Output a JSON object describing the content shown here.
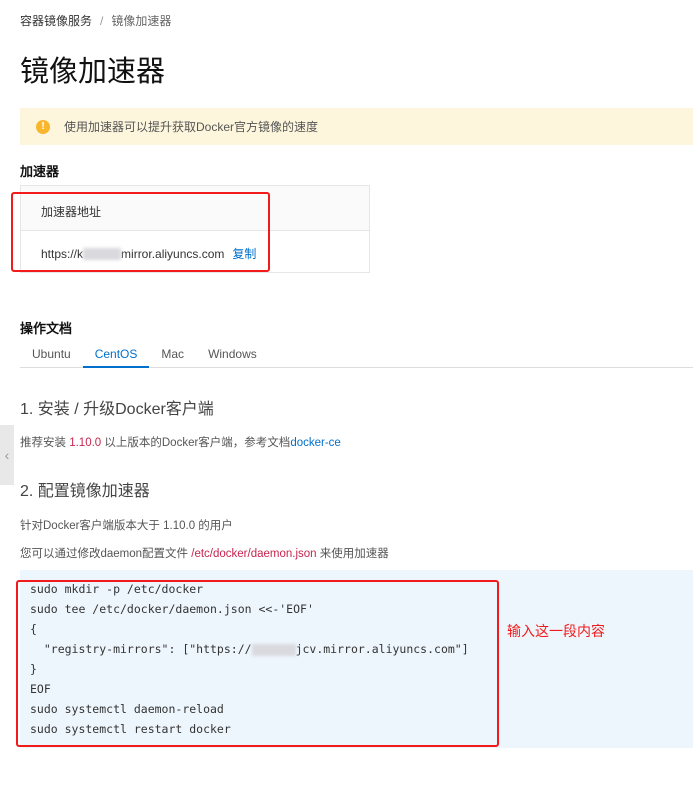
{
  "breadcrumb": {
    "parent": "容器镜像服务",
    "separator": "/",
    "current": "镜像加速器"
  },
  "page_title": "镜像加速器",
  "alert": {
    "icon": "warning-icon",
    "text": "使用加速器可以提升获取Docker官方镜像的速度"
  },
  "accelerator": {
    "section_title": "加速器",
    "column_header": "加速器地址",
    "url_prefix": "https://k",
    "url_suffix": "mirror.aliyuncs.com",
    "copy_label": "复制"
  },
  "docs": {
    "section_title": "操作文档",
    "tabs": [
      "Ubuntu",
      "CentOS",
      "Mac",
      "Windows"
    ],
    "active_tab": "CentOS",
    "step1_title": "1. 安装 / 升级Docker客户端",
    "step1_text_a": "推荐安装 ",
    "step1_version": "1.10.0",
    "step1_text_b": " 以上版本的Docker客户端，参考文档",
    "step1_link": "docker-ce",
    "step2_title": "2. 配置镜像加速器",
    "step2_text1": "针对Docker客户端版本大于 1.10.0 的用户",
    "step2_text2_a": "您可以通过修改daemon配置文件 ",
    "step2_path": "/etc/docker/daemon.json",
    "step2_text2_b": " 来使用加速器",
    "code_lines": [
      "sudo mkdir -p /etc/docker",
      "sudo tee /etc/docker/daemon.json <<-'EOF'",
      "{",
      "  \"registry-mirrors\": [\"https://",
      "}",
      "EOF",
      "sudo systemctl daemon-reload",
      "sudo systemctl restart docker"
    ],
    "code_line4_suffix": "jcv.mirror.aliyuncs.com\"]"
  },
  "annotation": "输入这一段内容",
  "colors": {
    "accent": "#0070cc",
    "highlight": "#f21b1b",
    "alert_bg": "#fdf6dd",
    "code_bg": "#eef6fd"
  }
}
